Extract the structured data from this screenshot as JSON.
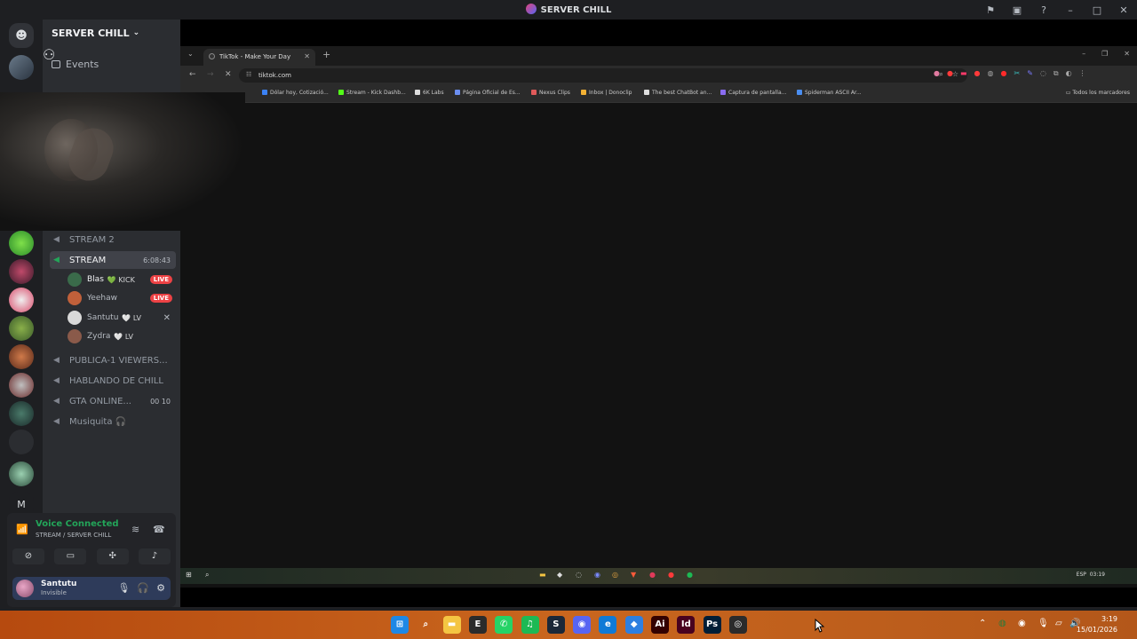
{
  "app": {
    "title": "SERVER CHILL",
    "window_controls": [
      "⚑",
      "▣",
      "?",
      "–",
      "□",
      "✕"
    ]
  },
  "server": {
    "name": "SERVER CHILL",
    "events_label": "Events"
  },
  "channels": [
    {
      "name": "STREAM 2",
      "active": false
    },
    {
      "name": "STREAM",
      "active": true,
      "timer": "6:08:43"
    },
    {
      "name": "PUBLICA-1 VIEWERS...",
      "active": false
    },
    {
      "name": "HABLANDO DE CHILL",
      "active": false
    },
    {
      "name": "GTA ONLINE...",
      "active": false,
      "counts": "00 10"
    },
    {
      "name": "Musiquita 🎧",
      "active": false
    }
  ],
  "members": [
    {
      "name": "Blas",
      "tag": "💚 KICK",
      "badge": "LIVE",
      "color": "#3a6b4a"
    },
    {
      "name": "Yeehaw",
      "tag": "",
      "badge": "LIVE",
      "color": "#c0603a"
    },
    {
      "name": "Santutu",
      "tag": "🤍 LV",
      "badge": "",
      "color": "#d9d9d9",
      "muted": true
    },
    {
      "name": "Zydra",
      "tag": "🤍 LV",
      "badge": "",
      "color": "#8a5a4a"
    }
  ],
  "voice": {
    "status": "Voice Connected",
    "channel": "STREAM / SERVER CHILL"
  },
  "user": {
    "name": "Santutu",
    "status": "Invisible"
  },
  "browser": {
    "tab_title": "TikTok - Make Your Day",
    "url": "tiktok.com",
    "bookmarks": [
      {
        "label": "Dólar hoy, Cotizació...",
        "color": "#3b82f6"
      },
      {
        "label": "Stream - Kick Dashb...",
        "color": "#53fc18"
      },
      {
        "label": "6K Labs",
        "color": "#dddddd"
      },
      {
        "label": "Página Oficial de Es...",
        "color": "#6b8ef0"
      },
      {
        "label": "Nexus Clips",
        "color": "#e05a5a"
      },
      {
        "label": "Inbox | Donoclip",
        "color": "#f2b134"
      },
      {
        "label": "The best ChatBot an...",
        "color": "#dddddd"
      },
      {
        "label": "Captura de pantalla...",
        "color": "#8a6cf0"
      },
      {
        "label": "Spiderman ASCII Ar...",
        "color": "#4a8ef0"
      }
    ],
    "all_bookmarks": "Todos los marcadores"
  },
  "inner_taskbar": {
    "lang": "ESP",
    "time": "03:19"
  },
  "taskbar": {
    "apps": [
      {
        "name": "windows-start-icon",
        "glyph": "⊞",
        "bg": "#1e88e5"
      },
      {
        "name": "search-icon",
        "glyph": "⌕",
        "bg": "transparent"
      },
      {
        "name": "file-explorer-icon",
        "glyph": "▬",
        "bg": "#f4c542"
      },
      {
        "name": "epic-games-icon",
        "glyph": "E",
        "bg": "#2b2b2b"
      },
      {
        "name": "whatsapp-icon",
        "glyph": "✆",
        "bg": "#25d366"
      },
      {
        "name": "spotify-icon",
        "glyph": "♫",
        "bg": "#1db954"
      },
      {
        "name": "steam-icon",
        "glyph": "S",
        "bg": "#1b2838"
      },
      {
        "name": "discord-icon",
        "glyph": "◉",
        "bg": "#5865f2"
      },
      {
        "name": "edge-icon",
        "glyph": "e",
        "bg": "#0f7ad6"
      },
      {
        "name": "store-icon",
        "glyph": "◆",
        "bg": "#2d7fe0"
      },
      {
        "name": "illustrator-icon",
        "glyph": "Ai",
        "bg": "#330000"
      },
      {
        "name": "indesign-icon",
        "glyph": "Id",
        "bg": "#49021f"
      },
      {
        "name": "photoshop-icon",
        "glyph": "Ps",
        "bg": "#001e36"
      },
      {
        "name": "chrome-icon",
        "glyph": "◎",
        "bg": "#2b2b2b"
      }
    ],
    "time": "3:19",
    "date": "15/01/2026"
  }
}
